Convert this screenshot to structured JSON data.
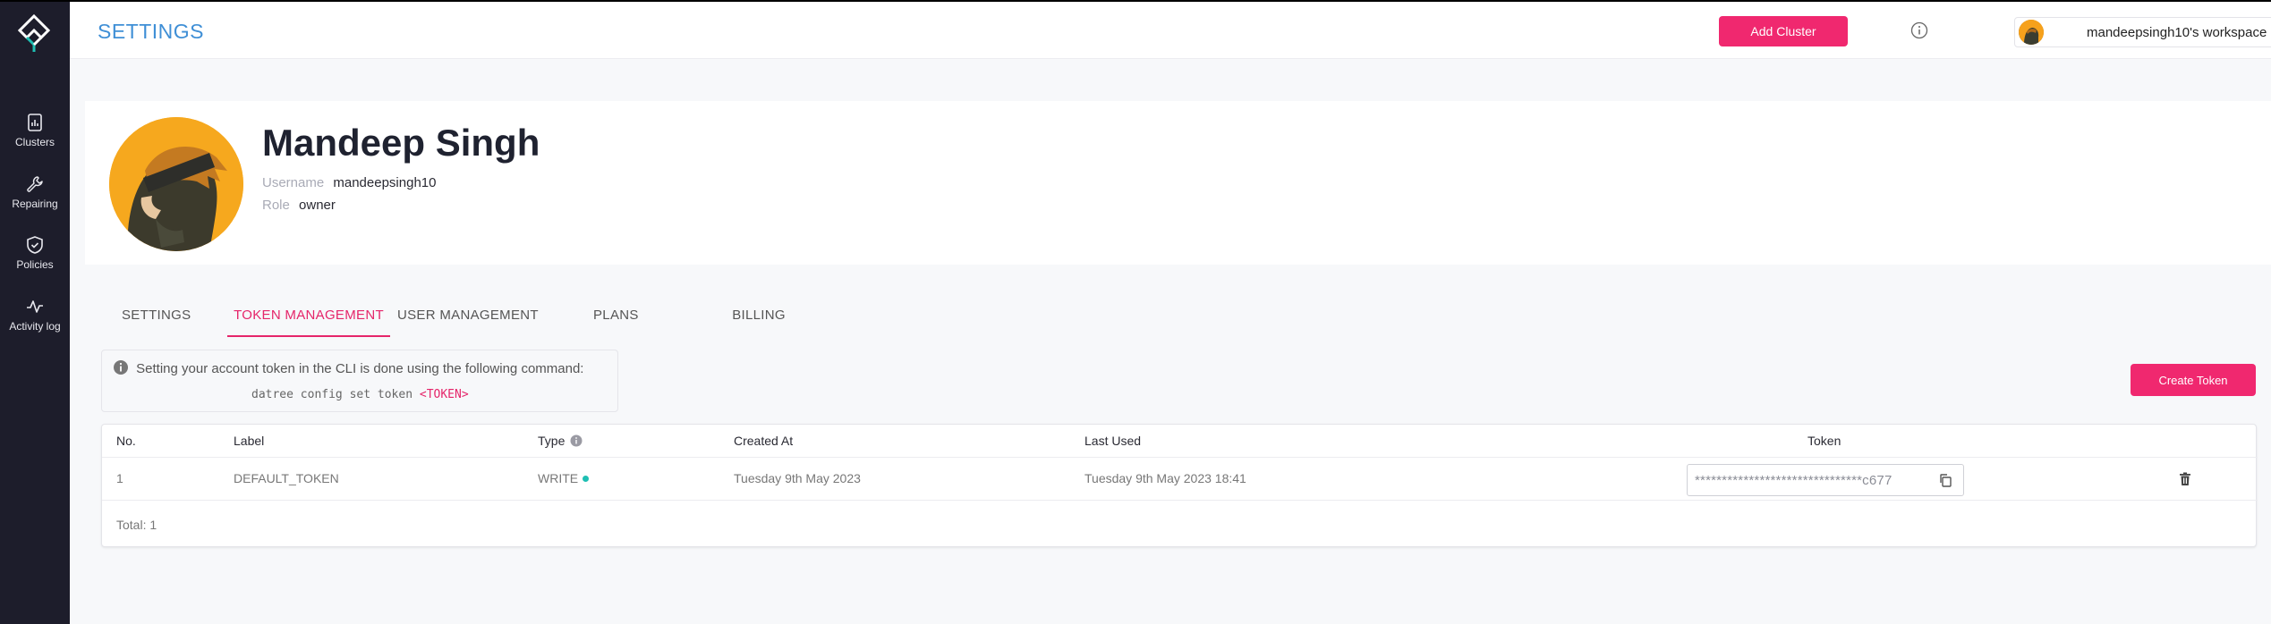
{
  "sidebar": {
    "items": [
      {
        "label": "Clusters",
        "icon": "clusters-icon"
      },
      {
        "label": "Repairing",
        "icon": "wrench-icon"
      },
      {
        "label": "Policies",
        "icon": "shield-icon"
      },
      {
        "label": "Activity log",
        "icon": "activity-icon"
      }
    ]
  },
  "header": {
    "title": "SETTINGS",
    "add_cluster_label": "Add Cluster",
    "workspace_name": "mandeepsingh10's workspace"
  },
  "profile": {
    "name": "Mandeep Singh",
    "username_label": "Username",
    "username": "mandeepsingh10",
    "role_label": "Role",
    "role": "owner"
  },
  "tabs": [
    {
      "label": "SETTINGS",
      "active": false
    },
    {
      "label": "TOKEN MANAGEMENT",
      "active": true
    },
    {
      "label": "USER MANAGEMENT",
      "active": false
    },
    {
      "label": "PLANS",
      "active": false
    },
    {
      "label": "BILLING",
      "active": false
    }
  ],
  "cli_info": {
    "text": "Setting your account token in the CLI is done using the following command:",
    "cmd_1": "datree",
    "cmd_2": "config",
    "cmd_3": "set",
    "cmd_4": "token",
    "token_placeholder": "<TOKEN>"
  },
  "create_token_label": "Create Token",
  "table": {
    "headers": {
      "no": "No.",
      "label": "Label",
      "type": "Type",
      "created_at": "Created At",
      "last_used": "Last Used",
      "token": "Token"
    },
    "rows": [
      {
        "no": "1",
        "label": "DEFAULT_TOKEN",
        "type": "WRITE",
        "created_at": "Tuesday 9th May 2023",
        "last_used": "Tuesday 9th May 2023 18:41",
        "token": "*******************************c677"
      }
    ],
    "total": "Total: 1"
  },
  "colors": {
    "accent": "#f0286f",
    "title_blue": "#3f8fd6",
    "sidebar_bg": "#1d1d2b",
    "status_teal": "#1ebfb3"
  }
}
